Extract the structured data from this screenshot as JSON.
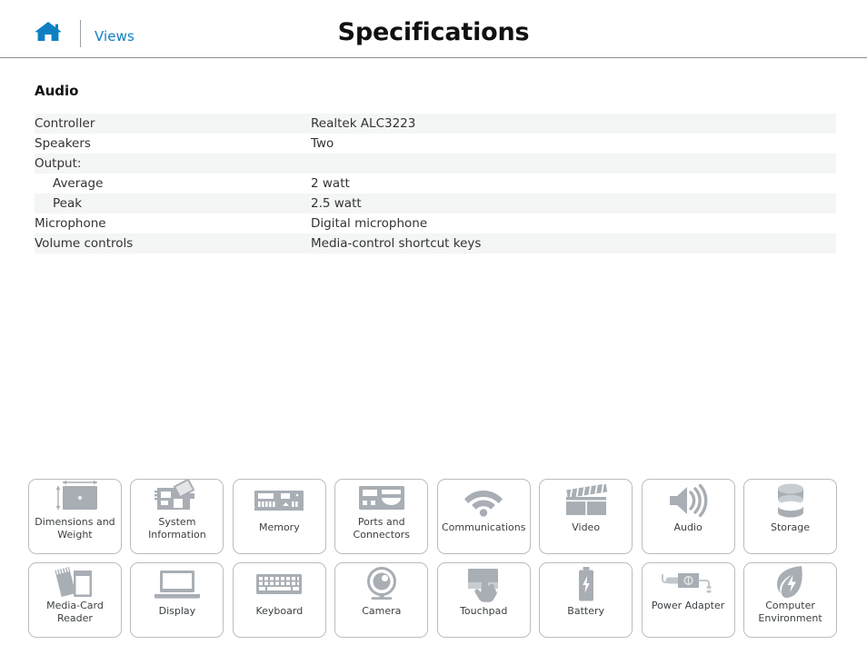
{
  "header": {
    "home_icon": "home-icon",
    "views_label": "Views",
    "title": "Specifications"
  },
  "section": {
    "title": "Audio"
  },
  "spec_table": {
    "rows": [
      {
        "label": "Controller",
        "value": "Realtek ALC3223",
        "indent": false,
        "shaded": true
      },
      {
        "label": "Speakers",
        "value": "Two",
        "indent": false,
        "shaded": false
      },
      {
        "label": "Output:",
        "value": "",
        "indent": false,
        "shaded": true
      },
      {
        "label": "Average",
        "value": "2 watt",
        "indent": true,
        "shaded": false
      },
      {
        "label": "Peak",
        "value": "2.5 watt",
        "indent": true,
        "shaded": true
      },
      {
        "label": "Microphone",
        "value": "Digital microphone",
        "indent": false,
        "shaded": false
      },
      {
        "label": "Volume controls",
        "value": "Media-control shortcut keys",
        "indent": false,
        "shaded": true
      }
    ]
  },
  "tiles": {
    "row1": [
      {
        "label": "Dimensions and Weight",
        "icon": "laptop-dimensions-icon"
      },
      {
        "label": "System Information",
        "icon": "motherboard-icon"
      },
      {
        "label": "Memory",
        "icon": "memory-module-icon"
      },
      {
        "label": "Ports and Connectors",
        "icon": "ports-icon"
      },
      {
        "label": "Communications",
        "icon": "wifi-icon"
      },
      {
        "label": "Video",
        "icon": "clapperboard-icon"
      },
      {
        "label": "Audio",
        "icon": "speaker-icon"
      },
      {
        "label": "Storage",
        "icon": "drive-cylinder-icon"
      }
    ],
    "row2": [
      {
        "label": "Media-Card Reader",
        "icon": "memory-card-icon"
      },
      {
        "label": "Display",
        "icon": "monitor-icon"
      },
      {
        "label": "Keyboard",
        "icon": "keyboard-icon"
      },
      {
        "label": "Camera",
        "icon": "webcam-icon"
      },
      {
        "label": "Touchpad",
        "icon": "touchpad-hand-icon"
      },
      {
        "label": "Battery",
        "icon": "battery-icon"
      },
      {
        "label": "Power Adapter",
        "icon": "power-adapter-icon"
      },
      {
        "label": "Computer Environment",
        "icon": "leaf-icon"
      }
    ]
  },
  "colors": {
    "accent_blue": "#0f7fc4",
    "row_shade": "#f4f5f5",
    "icon_gray": "#a8aeb4",
    "tile_border": "#b9bdc1",
    "text": "#333333"
  }
}
